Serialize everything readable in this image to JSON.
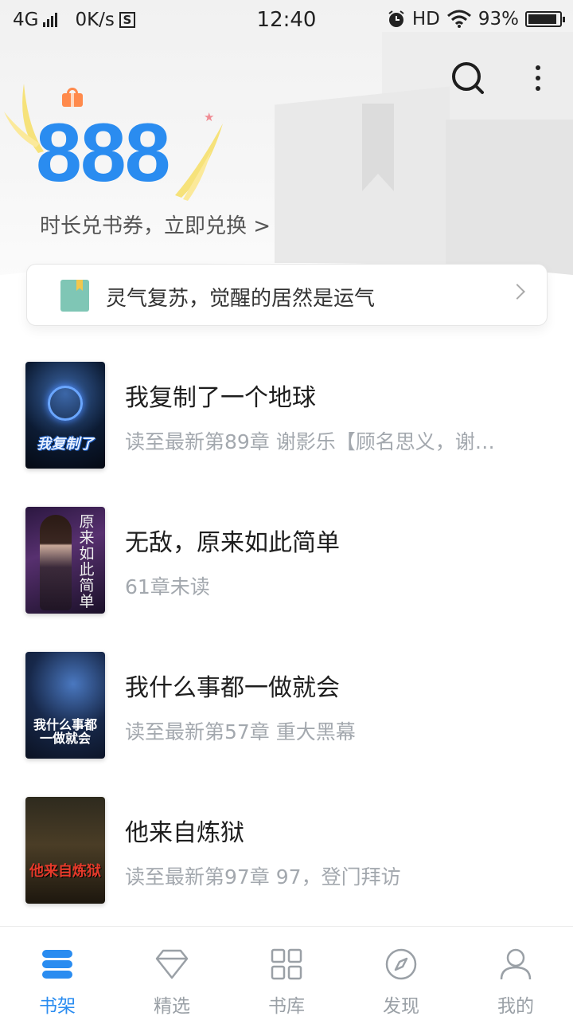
{
  "status_bar": {
    "network": "4G",
    "speed": "0K/s",
    "s_badge": "S",
    "time": "12:40",
    "hd": "HD",
    "battery_pct": "93%",
    "battery_level": 0.93
  },
  "header": {
    "icons": [
      "search-icon",
      "more-icon"
    ]
  },
  "promo": {
    "number": "888",
    "subtitle": "时长兑书券，立即兑换 >",
    "gift_icon": "gift-icon"
  },
  "notice": {
    "text": "灵气复苏，觉醒的居然是运气",
    "icon": "book-icon"
  },
  "books": [
    {
      "title": "我复制了一个地球",
      "meta": "读至最新第89章 谢影乐【顾名思义，谢…",
      "cover_text": "我复制了"
    },
    {
      "title": "无敌，原来如此简单",
      "meta": "61章未读",
      "cover_text": "原来如此简单"
    },
    {
      "title": "我什么事都一做就会",
      "meta": "读至最新第57章 重大黑幕",
      "cover_text": "我什么事都一做就会"
    },
    {
      "title": "他来自炼狱",
      "meta": "读至最新第97章 97，登门拜访",
      "cover_text": "他来自炼狱"
    }
  ],
  "tabs": [
    {
      "label": "书架",
      "icon": "bookshelf-icon",
      "active": true
    },
    {
      "label": "精选",
      "icon": "diamond-icon",
      "active": false
    },
    {
      "label": "书库",
      "icon": "grid-icon",
      "active": false
    },
    {
      "label": "发现",
      "icon": "compass-icon",
      "active": false
    },
    {
      "label": "我的",
      "icon": "user-icon",
      "active": false
    }
  ],
  "colors": {
    "accent": "#2a8cf0",
    "muted_text": "#a3a8ae",
    "promo_star": "#f08b93",
    "gift": "#ff8a4c"
  }
}
